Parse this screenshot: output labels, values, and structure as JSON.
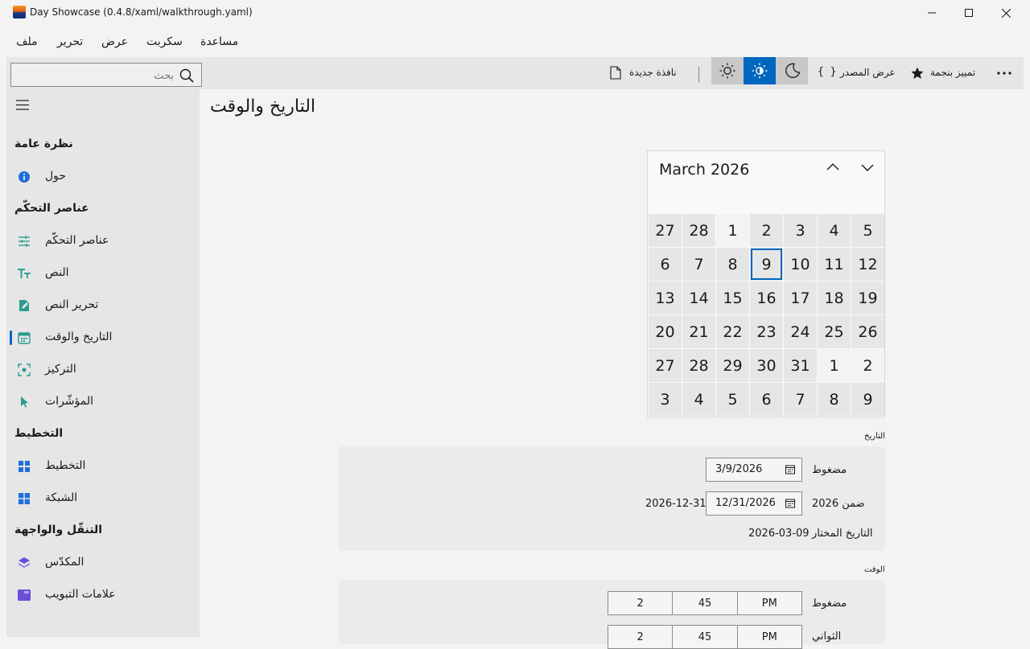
{
  "window": {
    "title": "Day Showcase (0.4.8/xaml/walkthrough.yaml)"
  },
  "menu": [
    "ملف",
    "تحرير",
    "عرض",
    "سكربت",
    "مساعدة"
  ],
  "toolbar": {
    "search_placeholder": "بحث",
    "new_window": "نافذة جديدة",
    "view_source": "عرض المصدر",
    "star": "تمييز بنجمة",
    "source_glyph": "{ }"
  },
  "sidebar": {
    "sections": [
      {
        "title": "نظرة عامة",
        "items": [
          {
            "label": "حول",
            "icon": "info-icon"
          }
        ]
      },
      {
        "title": "عناصر التحكّم",
        "items": [
          {
            "label": "عناصر التحكّم",
            "icon": "sliders-icon"
          },
          {
            "label": "النص",
            "icon": "text-size-icon"
          },
          {
            "label": "تحرير النص",
            "icon": "edit-text-icon"
          },
          {
            "label": "التاريخ والوقت",
            "icon": "calendar-icon",
            "selected": true
          },
          {
            "label": "التركيز",
            "icon": "focus-icon"
          },
          {
            "label": "المؤشّرات",
            "icon": "cursor-icon"
          }
        ]
      },
      {
        "title": "التخطيط",
        "items": [
          {
            "label": "التخطيط",
            "icon": "layout-icon"
          },
          {
            "label": "الشبكة",
            "icon": "grid-icon"
          }
        ]
      },
      {
        "title": "التنقّل والواجهة",
        "items": [
          {
            "label": "المكدّس",
            "icon": "stack-icon"
          },
          {
            "label": "علامات التبويب",
            "icon": "tabs-icon"
          }
        ]
      }
    ]
  },
  "page": {
    "title": "التاريخ والوقت"
  },
  "calendar": {
    "month_label": "March 2026",
    "today": "9",
    "rows": [
      [
        [
          "27",
          "in"
        ],
        [
          "28",
          "in"
        ],
        [
          "1",
          "out"
        ],
        [
          "2",
          "in"
        ],
        [
          "3",
          "in"
        ],
        [
          "4",
          "in"
        ],
        [
          "5",
          "in"
        ]
      ],
      [
        [
          "6",
          "in"
        ],
        [
          "7",
          "in"
        ],
        [
          "8",
          "in"
        ],
        [
          "9",
          "today"
        ],
        [
          "10",
          "in"
        ],
        [
          "11",
          "in"
        ],
        [
          "12",
          "in"
        ]
      ],
      [
        [
          "13",
          "in"
        ],
        [
          "14",
          "in"
        ],
        [
          "15",
          "in"
        ],
        [
          "16",
          "in"
        ],
        [
          "17",
          "in"
        ],
        [
          "18",
          "in"
        ],
        [
          "19",
          "in"
        ]
      ],
      [
        [
          "20",
          "in"
        ],
        [
          "21",
          "in"
        ],
        [
          "22",
          "in"
        ],
        [
          "23",
          "in"
        ],
        [
          "24",
          "in"
        ],
        [
          "25",
          "in"
        ],
        [
          "26",
          "in"
        ]
      ],
      [
        [
          "27",
          "in"
        ],
        [
          "28",
          "in"
        ],
        [
          "29",
          "in"
        ],
        [
          "30",
          "in"
        ],
        [
          "31",
          "in"
        ],
        [
          "1",
          "out"
        ],
        [
          "2",
          "out"
        ]
      ],
      [
        [
          "3",
          "in"
        ],
        [
          "4",
          "in"
        ],
        [
          "5",
          "in"
        ],
        [
          "6",
          "in"
        ],
        [
          "7",
          "in"
        ],
        [
          "8",
          "in"
        ],
        [
          "9",
          "in"
        ]
      ]
    ]
  },
  "date_section": {
    "label": "التاريخ",
    "rows": [
      {
        "label": "مضغوط",
        "value": "3/9/2026"
      },
      {
        "label": "ضمن 2026",
        "value": "12/31/2026",
        "side_value": "2026-12-31"
      }
    ],
    "selected_label": "التاريخ المختار",
    "selected_value": "2026-03-09"
  },
  "time_section": {
    "label": "الوقت",
    "rows": [
      {
        "label": "مضغوط",
        "hour": "2",
        "minute": "45",
        "period": "PM"
      },
      {
        "label": "الثواني",
        "hour": "2",
        "minute": "45",
        "period": "PM"
      }
    ]
  },
  "colors": {
    "accent": "#0067c0",
    "sidebar_bg": "#e6e6e6",
    "nav_icon_teal": "#2a9d8f",
    "nav_icon_blue": "#1e6fd9",
    "nav_icon_purple": "#6b4fd8"
  }
}
